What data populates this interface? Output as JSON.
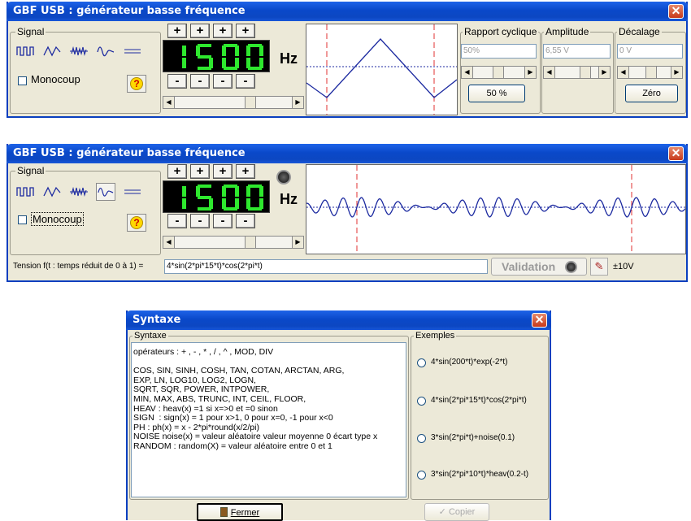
{
  "win1": {
    "title": "GBF USB : générateur basse fréquence",
    "close": "✕",
    "signal_label": "Signal",
    "monocoup_label": "Monocoup",
    "help": "?",
    "plus": "+",
    "minus": "-",
    "digits": "150",
    "unit": "Hz",
    "rapport": {
      "label": "Rapport cyclique",
      "value": "50%",
      "button": "50 %"
    },
    "amplitude": {
      "label": "Amplitude",
      "value": "6,55 V"
    },
    "decalage": {
      "label": "Décalage",
      "value": "0 V",
      "button": "Zéro"
    }
  },
  "win2": {
    "title": "GBF USB : générateur basse fréquence",
    "close": "✕",
    "signal_label": "Signal",
    "monocoup_label": "Monocoup",
    "help": "?",
    "digits": "150",
    "unit": "Hz",
    "tension_label": "Tension f(t : temps réduit de 0 à 1) =",
    "formula": "4*sin(2*pi*15*t)*cos(2*pi*t)",
    "validation": "Validation",
    "range": "±10V"
  },
  "syntaxe": {
    "title": "Syntaxe",
    "close": "✕",
    "group_label": "Syntaxe",
    "examples_label": "Exemples",
    "text": "opérateurs : + , - , * , / , ^ , MOD, DIV\n\nCOS, SIN, SINH, COSH, TAN, COTAN, ARCTAN, ARG,\nEXP, LN, LOG10, LOG2, LOGN,\nSQRT, SQR, POWER, INTPOWER,\nMIN, MAX, ABS, TRUNC, INT, CEIL, FLOOR,\nHEAV : heav(x) =1 si x=>0 et =0 sinon\nSIGN  : sign(x) = 1 pour x>1, 0 pour x=0, -1 pour x<0\nPH : ph(x) = x - 2*pi*round(x/2/pi)\nNOISE noise(x) = valeur aléatoire valeur moyenne 0 écart type x\nRANDOM : random(X) = valeur aléatoire entre 0 et 1",
    "examples": [
      "4*sin(200*t)*exp(-2*t)",
      "4*sin(2*pi*15*t)*cos(2*pi*t)",
      "3*sin(2*pi*t)+noise(0.1)",
      "3*sin(2*pi*10*t)*heav(0.2-t)"
    ],
    "fermer": "Fermer",
    "copier": "Copier"
  },
  "colors": {
    "title_bar": "#0a48c9",
    "digit_green": "#2ee82e",
    "trace": "#1c2aa0",
    "cursor_red": "#e03030"
  },
  "icons": [
    "square-wave-icon",
    "triangle-wave-icon",
    "noise-wave-icon",
    "damped-wave-icon",
    "dc-level-icon",
    "help-icon",
    "record-icon",
    "door-icon",
    "checkmark-icon"
  ]
}
